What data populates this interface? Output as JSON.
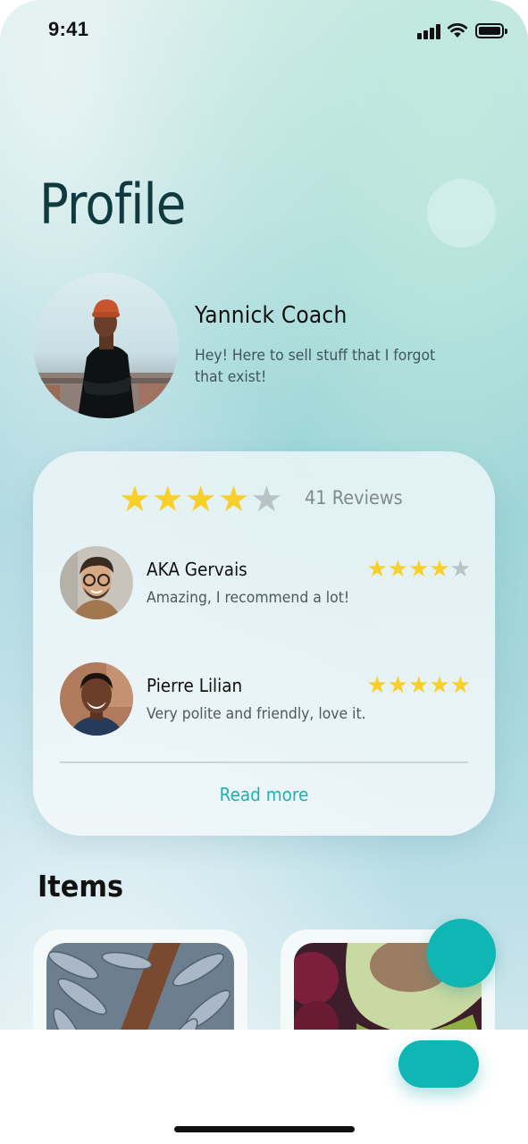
{
  "status_bar": {
    "time": "9:41"
  },
  "page": {
    "title": "Profile"
  },
  "profile": {
    "name": "Yannick Coach",
    "bio": "Hey! Here to sell stuff that I forgot that exist!"
  },
  "reviews": {
    "rating": 4,
    "max_rating": 5,
    "count_label": "41 Reviews",
    "items": [
      {
        "name": "AKA Gervais",
        "text": "Amazing, I recommend a lot!",
        "rating": 4
      },
      {
        "name": "Pierre Lilian",
        "text": "Very polite and friendly, love it.",
        "rating": 5
      }
    ],
    "read_more_label": "Read more"
  },
  "items_section": {
    "title": "Items"
  },
  "colors": {
    "accent": "#10b6b4",
    "star_on": "#f9cf2a",
    "star_off": "#b7c3c6",
    "title": "#103a3d"
  },
  "icons": {
    "signal": "signal-icon",
    "wifi": "wifi-icon",
    "battery": "battery-icon",
    "star": "star-icon"
  }
}
